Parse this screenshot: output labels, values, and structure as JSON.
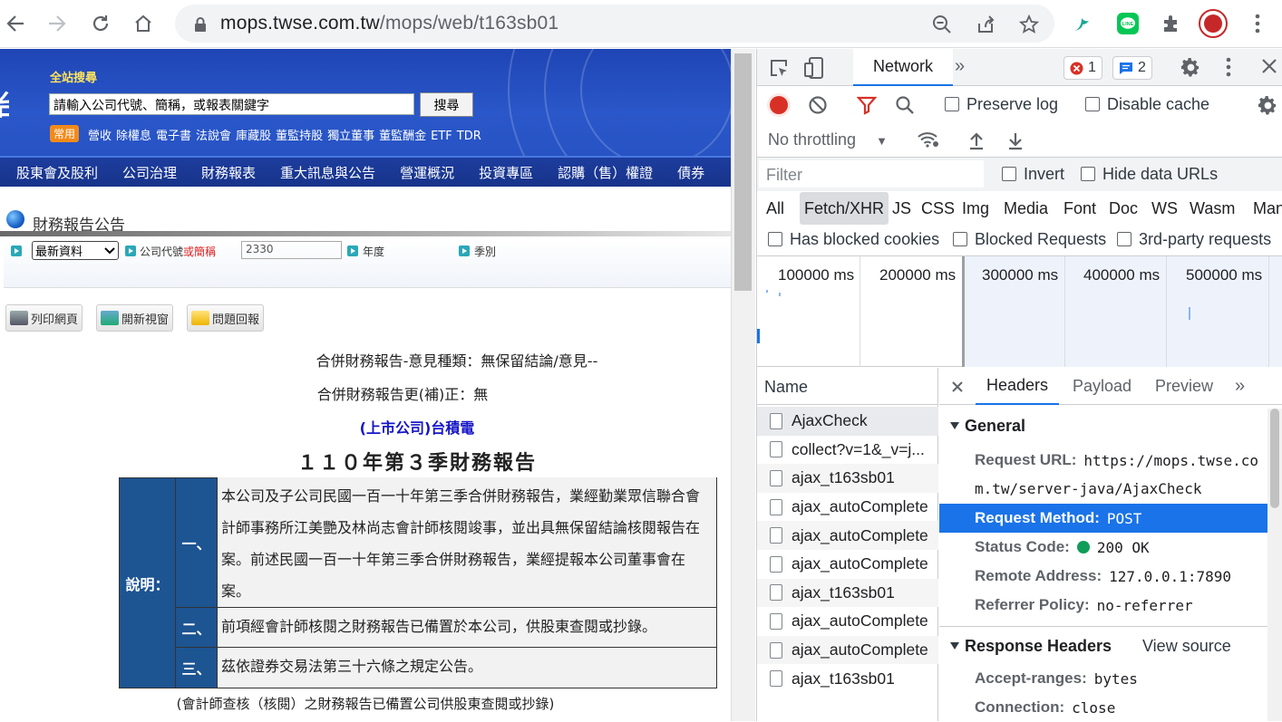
{
  "browser": {
    "url_host": "mops.twse.com.tw",
    "url_path": "/mops/web/t163sb01"
  },
  "site": {
    "search_label": "全站搜尋",
    "search_placeholder": "請輸入公司代號、簡稱，或報表關鍵字",
    "search_button": "搜尋",
    "common_tag": "常用",
    "quick_links": [
      "營收",
      "除權息",
      "電子書",
      "法說會",
      "庫藏股",
      "董監持股",
      "獨立董事",
      "董監酬金",
      "ETF",
      "TDR"
    ],
    "menu": [
      "股東會及股利",
      "公司治理",
      "財務報表",
      "重大訊息與公告",
      "營運概況",
      "投資專區",
      "認購（售）權證",
      "債券"
    ],
    "section_title": "財務報告公告",
    "filter": {
      "select_value": "最新資料",
      "company_label_prefix": "公司代號",
      "company_label_or": "或",
      "company_label_suffix": "簡稱",
      "company_value": "2330",
      "year_label": "年度",
      "season_label": "季別"
    },
    "tool_buttons": [
      "列印網頁",
      "開新視窗",
      "問題回報"
    ],
    "opinion_line": "合併財務報告-意見種類：無保留結論/意見--",
    "restated_line": "合併財務報告更(補)正：無",
    "company": "(上市公司)台積電",
    "report_title": "１１０年第３季財務報告",
    "notice": {
      "head": "說明：",
      "rows": [
        {
          "num": "一、",
          "text": "本公司及子公司民國一百一十年第三季合併財務報告，業經勤業眾信聯合會計師事務所江美艷及林尚志會計師核閱竣事，並出具無保留結論核閱報告在案。前述民國一百一十年第三季合併財務報告，業經提報本公司董事會在案。"
        },
        {
          "num": "二、",
          "text": "前項經會計師核閱之財務報告已備置於本公司，供股東查閱或抄錄。"
        },
        {
          "num": "三、",
          "text": "茲依證券交易法第三十六條之規定公告。"
        }
      ]
    },
    "foot_note": "(會計師查核（核閱）之財務報告已備置公司供股東查閱或抄錄)"
  },
  "devtools": {
    "tab": "Network",
    "error_count": "1",
    "message_count": "2",
    "preserve_log": "Preserve log",
    "disable_cache": "Disable cache",
    "throttling": "No throttling",
    "filter_placeholder": "Filter",
    "invert": "Invert",
    "hide_data_urls": "Hide data URLs",
    "types": [
      "All",
      "Fetch/XHR",
      "JS",
      "CSS",
      "Img",
      "Media",
      "Font",
      "Doc",
      "WS",
      "Wasm",
      "Mani"
    ],
    "active_type": "Fetch/XHR",
    "has_blocked_cookies": "Has blocked cookies",
    "blocked_requests": "Blocked Requests",
    "third_party": "3rd-party requests",
    "timeline_labels": [
      "100000 ms",
      "200000 ms",
      "300000 ms",
      "400000 ms",
      "500000 ms"
    ],
    "name_header": "Name",
    "requests": [
      "AjaxCheck",
      "collect?v=1&_v=j...",
      "ajax_t163sb01",
      "ajax_autoComplete",
      "ajax_autoComplete",
      "ajax_autoComplete",
      "ajax_t163sb01",
      "ajax_autoComplete",
      "ajax_autoComplete",
      "ajax_t163sb01"
    ],
    "detail_tabs": [
      "Headers",
      "Payload",
      "Preview"
    ],
    "general_title": "General",
    "general": {
      "request_url_key": "Request URL:",
      "request_url_line1": "https://mops.twse.co",
      "request_url_line2": "m.tw/server-java/AjaxCheck",
      "method_key": "Request Method:",
      "method_value": "POST",
      "status_key": "Status Code:",
      "status_value": "200 OK",
      "remote_key": "Remote Address:",
      "remote_value": "127.0.0.1:7890",
      "referrer_key": "Referrer Policy:",
      "referrer_value": "no-referrer"
    },
    "response_title": "Response Headers",
    "view_source": "View source",
    "response": {
      "accept_ranges_key": "Accept-ranges:",
      "accept_ranges_value": "bytes",
      "connection_key": "Connection:",
      "connection_value": "close"
    },
    "colors": {
      "accent": "#1a73e8",
      "record": "#d93025",
      "status_ok": "#0f9d58"
    }
  }
}
